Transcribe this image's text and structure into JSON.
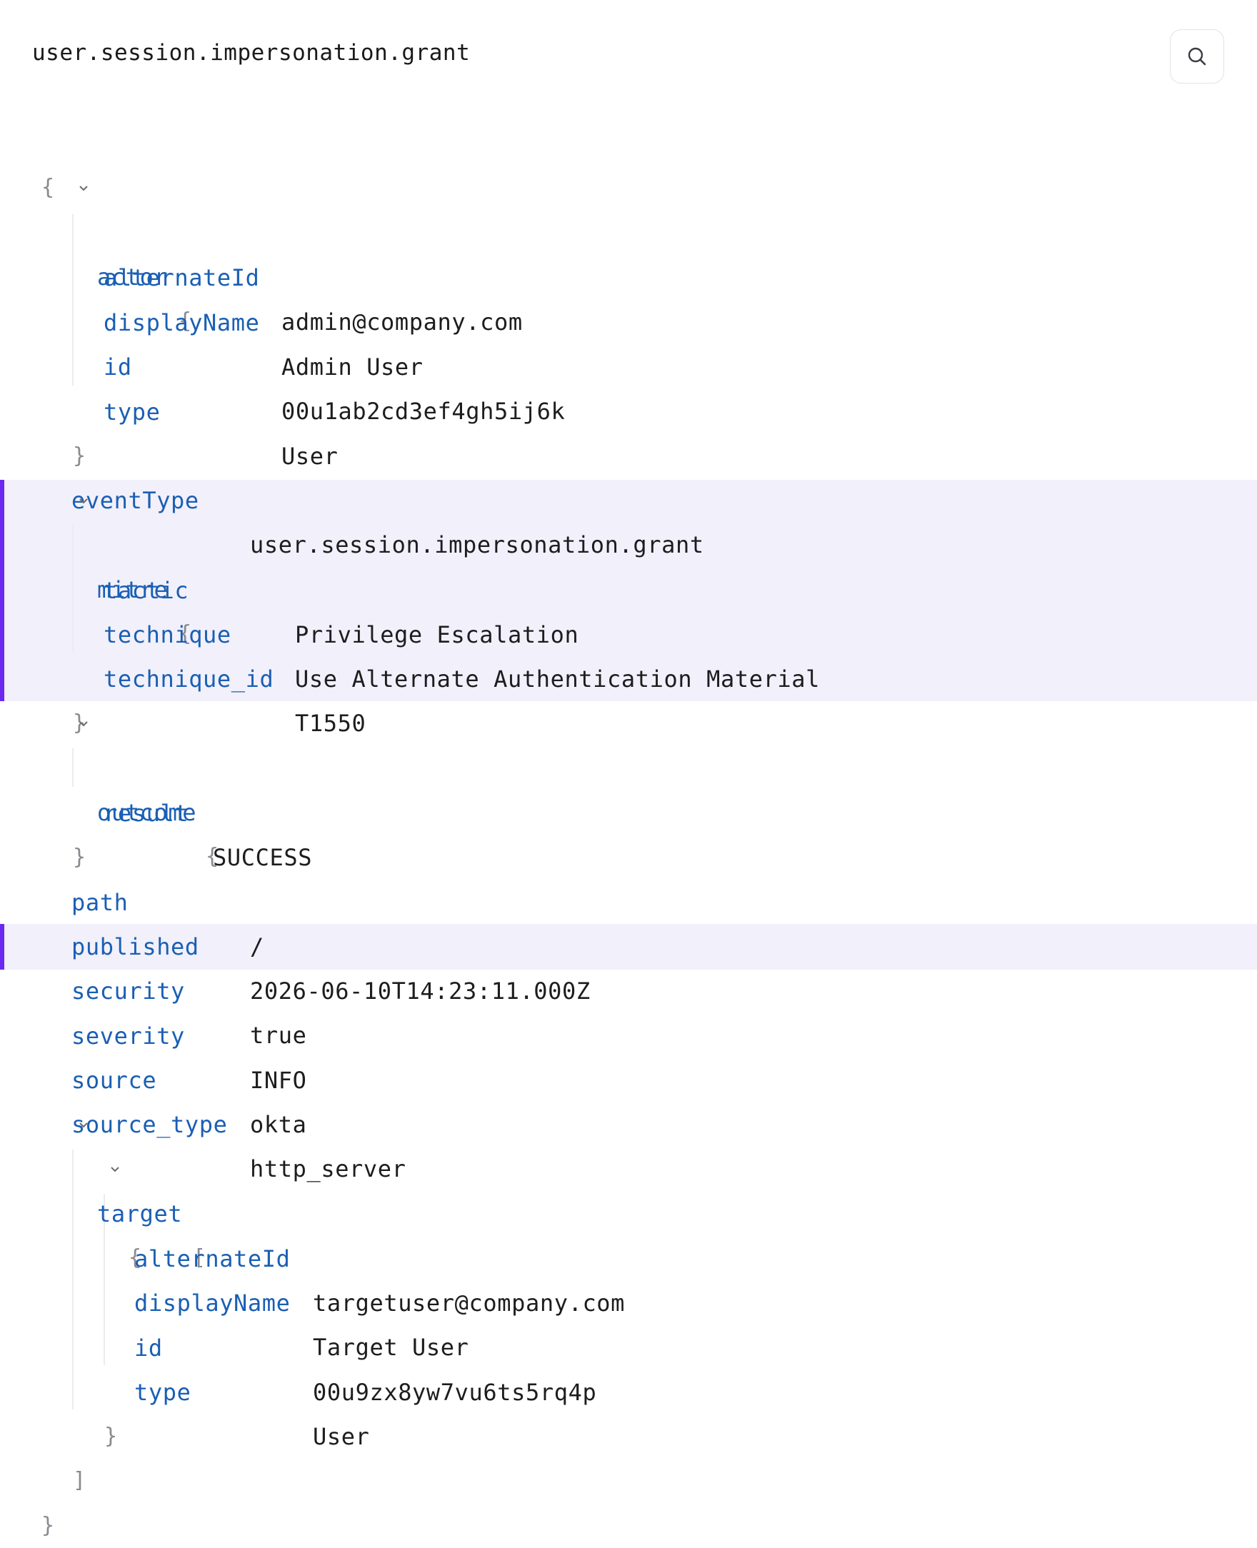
{
  "header": {
    "title": "user.session.impersonation.grant",
    "search_icon": "search-icon"
  },
  "brackets": {
    "open_brace": "{",
    "close_brace": "}",
    "open_bracket": "[",
    "close_bracket": "]"
  },
  "actor": {
    "key": "actor",
    "fields": [
      {
        "key": "alternateId",
        "value": "admin@company.com"
      },
      {
        "key": "displayName",
        "value": "Admin User"
      },
      {
        "key": "id",
        "value": "00u1ab2cd3ef4gh5ij6k"
      },
      {
        "key": "type",
        "value": "User"
      }
    ]
  },
  "eventType": {
    "key": "eventType",
    "value": "user.session.impersonation.grant"
  },
  "mitre": {
    "key": "mitre",
    "fields": [
      {
        "key": "tactic",
        "value": "Privilege Escalation"
      },
      {
        "key": "technique",
        "value": "Use Alternate Authentication Material"
      },
      {
        "key": "technique_id",
        "value": "T1550"
      }
    ]
  },
  "outcome": {
    "key": "outcome",
    "fields": [
      {
        "key": "result",
        "value": "SUCCESS"
      }
    ]
  },
  "path": {
    "key": "path",
    "value": "/"
  },
  "published": {
    "key": "published",
    "value": "2026-06-10T14:23:11.000Z"
  },
  "security": {
    "key": "security",
    "value": "true"
  },
  "severity": {
    "key": "severity",
    "value": "INFO"
  },
  "source": {
    "key": "source",
    "value": "okta"
  },
  "source_type": {
    "key": "source_type",
    "value": "http_server"
  },
  "target": {
    "key": "target",
    "items": [
      {
        "fields": [
          {
            "key": "alternateId",
            "value": "targetuser@company.com"
          },
          {
            "key": "displayName",
            "value": "Target User"
          },
          {
            "key": "id",
            "value": "00u9zx8yw7vu6ts5rq4p"
          },
          {
            "key": "type",
            "value": "User"
          }
        ]
      }
    ]
  },
  "colors": {
    "key": "#1a5fb4",
    "value": "#1d1d1f",
    "highlight_bg": "#f2f0fa",
    "highlight_bar": "#6d28f0"
  }
}
